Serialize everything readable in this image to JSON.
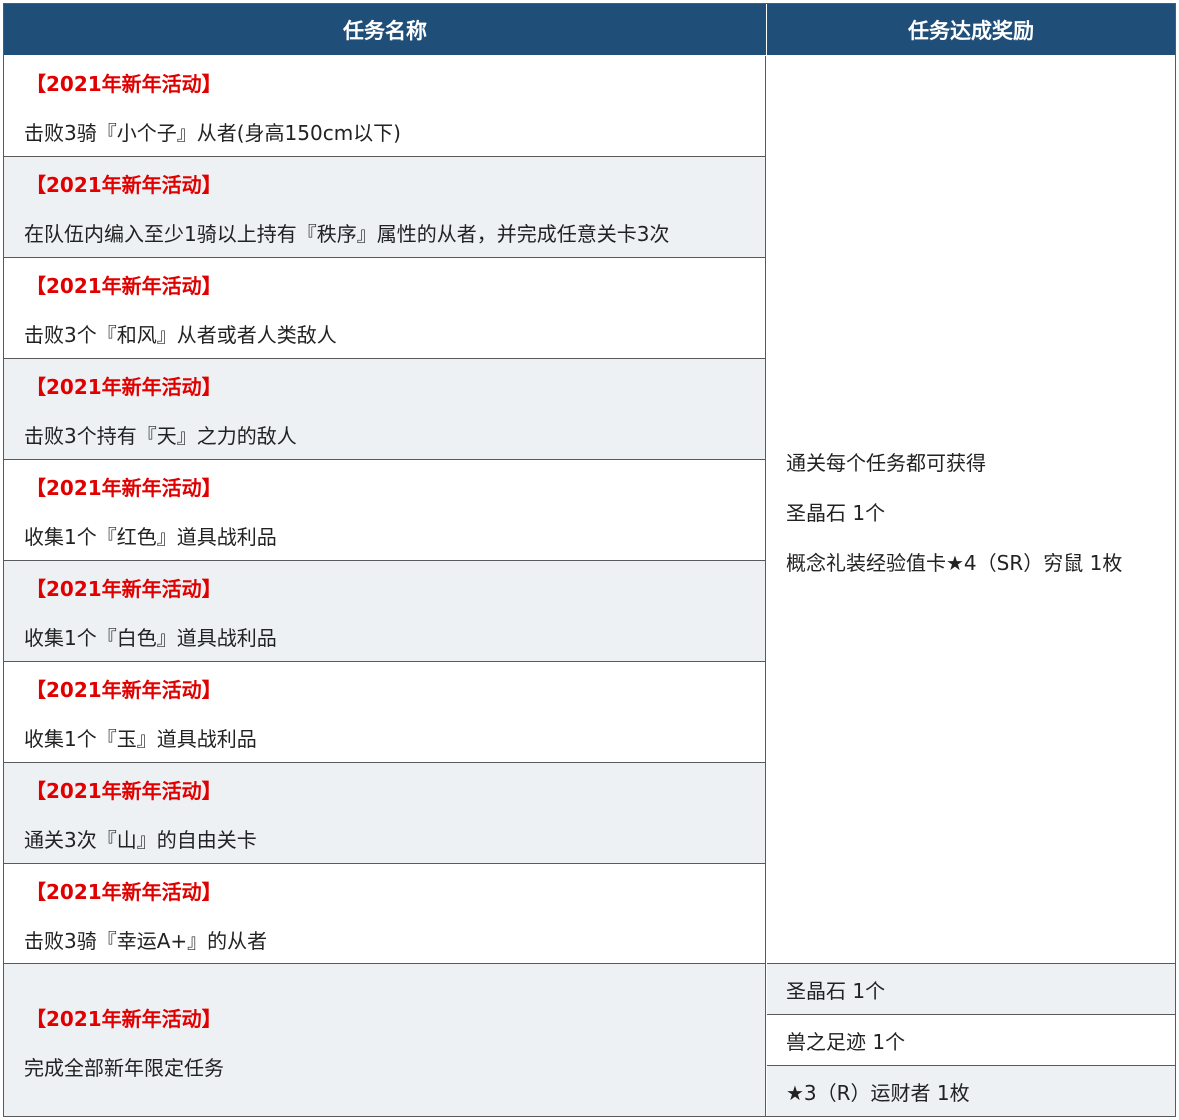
{
  "header": {
    "col_task": "任务名称",
    "col_reward": "任务达成奖励"
  },
  "tasks": [
    {
      "tag": "【2021年新年活动】",
      "desc": "击败3骑『小个子』从者(身高150cm以下)"
    },
    {
      "tag": "【2021年新年活动】",
      "desc": "在队伍内编入至少1骑以上持有『秩序』属性的从者，并完成任意关卡3次"
    },
    {
      "tag": "【2021年新年活动】",
      "desc": "击败3个『和风』从者或者人类敌人"
    },
    {
      "tag": "【2021年新年活动】",
      "desc": "击败3个持有『天』之力的敌人"
    },
    {
      "tag": "【2021年新年活动】",
      "desc": "收集1个『红色』道具战利品"
    },
    {
      "tag": "【2021年新年活动】",
      "desc": "收集1个『白色』道具战利品"
    },
    {
      "tag": "【2021年新年活动】",
      "desc": "收集1个『玉』道具战利品"
    },
    {
      "tag": "【2021年新年活动】",
      "desc": "通关3次『山』的自由关卡"
    },
    {
      "tag": "【2021年新年活动】",
      "desc": "击败3骑『幸运A+』的从者"
    }
  ],
  "shared_reward": {
    "lines": [
      "通关每个任务都可获得",
      "圣晶石 1个",
      "概念礼装经验值卡★4（SR）穷鼠 1枚"
    ]
  },
  "final_task": {
    "tag": "【2021年新年活动】",
    "desc": "完成全部新年限定任务",
    "rewards": [
      "圣晶石 1个",
      "兽之足迹 1个",
      "★3（R）运财者 1枚"
    ]
  },
  "colors": {
    "header_bg": "#1f4e79",
    "tag_red": "#e00000",
    "alt_row": "#edf1f4"
  }
}
